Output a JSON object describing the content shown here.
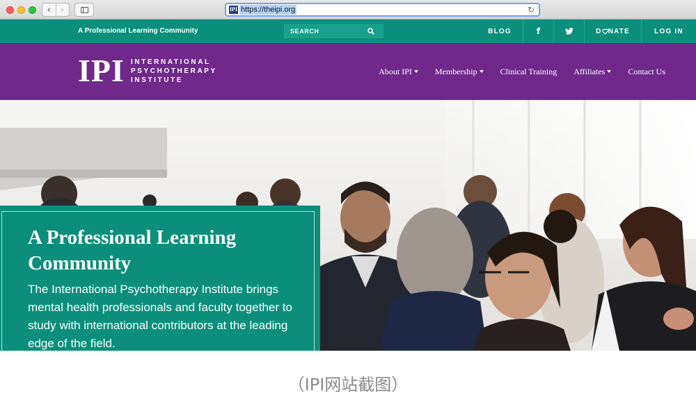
{
  "browser": {
    "url": "https://theipi.org",
    "favicon_text": "IPI",
    "back_glyph": "‹",
    "forward_glyph": "›",
    "reload_glyph": "↻"
  },
  "topbar": {
    "tagline": "A Professional Learning Community",
    "search_label": "SEARCH",
    "blog": "BLOG",
    "facebook_glyph": "f",
    "donate_prefix": "D",
    "donate_suffix": "NATE",
    "login": "LOG IN",
    "icons": [
      "search-icon",
      "facebook-icon",
      "twitter-icon",
      "heart-icon"
    ]
  },
  "header": {
    "logo_abbr": "IPI",
    "logo_name": "INTERNATIONAL PSYCHOTHERAPY INSTITUTE",
    "nav": {
      "about": "About IPI",
      "membership": "Membership",
      "clinical_training": "Clinical Training",
      "affiliates": "Affiliates",
      "contact": "Contact Us"
    }
  },
  "hero": {
    "title": "A Professional Learning Community",
    "body": "The International Psychotherapy Institute brings mental health professionals and faculty together to study with international contributors at the leading edge of the field."
  },
  "caption": "（IPI网站截图）",
  "colors": {
    "teal": "#0a8f7c",
    "purple": "#70288b",
    "white": "#ffffff"
  }
}
